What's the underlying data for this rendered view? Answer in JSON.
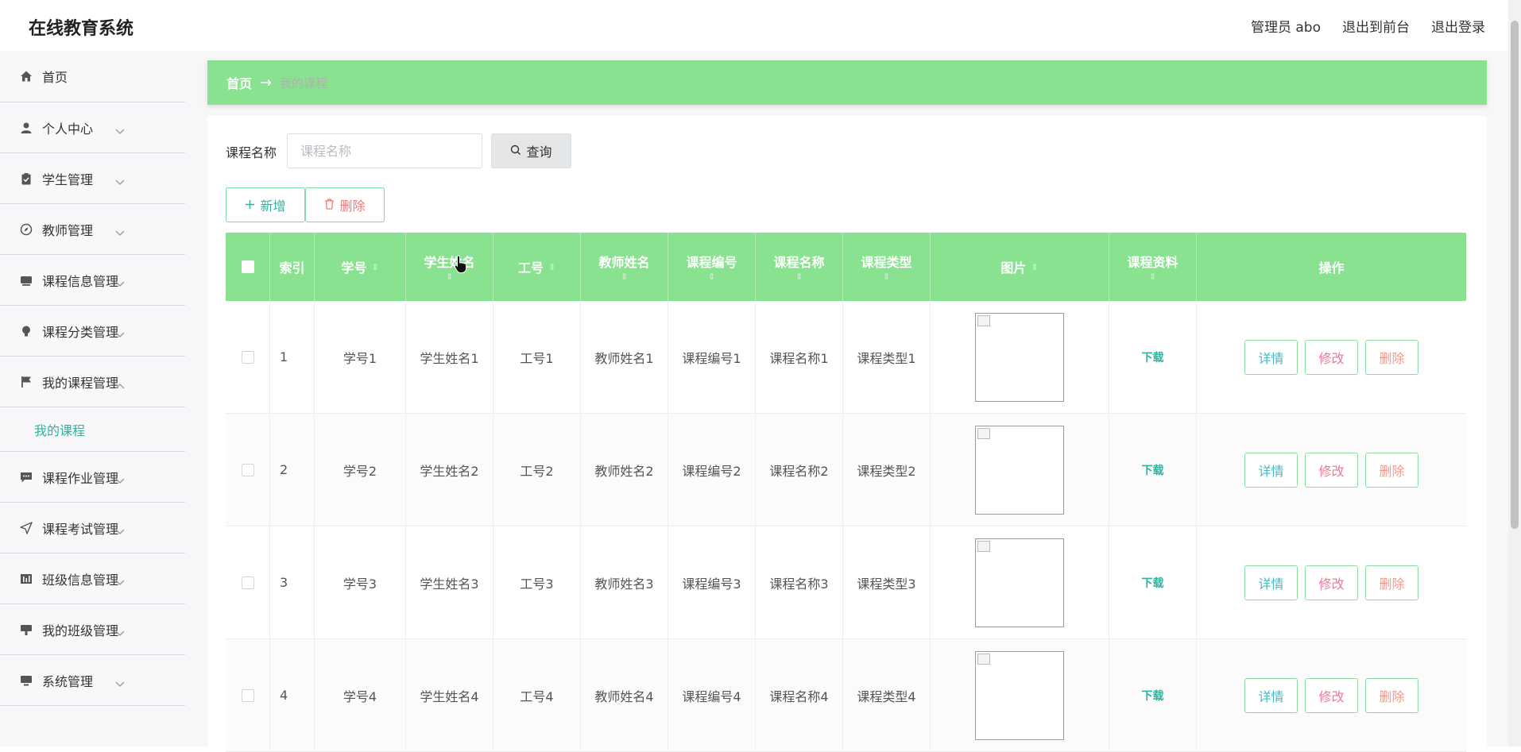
{
  "header": {
    "title": "在线教育系统",
    "user": "管理员 abo",
    "to_front": "退出到前台",
    "logout": "退出登录"
  },
  "sidebar": {
    "items": [
      {
        "label": "首页",
        "icon": "home-icon"
      },
      {
        "label": "个人中心",
        "icon": "user-icon"
      },
      {
        "label": "学生管理",
        "icon": "clipboard-icon"
      },
      {
        "label": "教师管理",
        "icon": "compass-icon"
      },
      {
        "label": "课程信息管理",
        "icon": "monitor-icon"
      },
      {
        "label": "课程分类管理",
        "icon": "bulb-icon"
      },
      {
        "label": "我的课程管理",
        "icon": "flag-icon"
      },
      {
        "label": "课程作业管理",
        "icon": "chat-icon"
      },
      {
        "label": "课程考试管理",
        "icon": "send-icon"
      },
      {
        "label": "班级信息管理",
        "icon": "bars-icon"
      },
      {
        "label": "我的班级管理",
        "icon": "tablet-icon"
      },
      {
        "label": "系统管理",
        "icon": "desktop-icon"
      }
    ],
    "sub_item": "我的课程"
  },
  "breadcrumb": {
    "home": "首页",
    "arrow": "→",
    "current": "我的课程"
  },
  "search": {
    "label": "课程名称",
    "placeholder": "课程名称",
    "button": "查询"
  },
  "actions": {
    "add": "新增",
    "delete": "删除"
  },
  "table": {
    "headers": [
      "索引",
      "学号",
      "学生姓名",
      "工号",
      "教师姓名",
      "课程编号",
      "课程名称",
      "课程类型",
      "图片",
      "课程资料",
      "操作"
    ],
    "rows": [
      {
        "index": "1",
        "student_no": "学号1",
        "student_name": "学生姓名1",
        "teacher_no": "工号1",
        "teacher_name": "教师姓名1",
        "course_no": "课程编号1",
        "course_name": "课程名称1",
        "course_type": "课程类型1",
        "material": "下载"
      },
      {
        "index": "2",
        "student_no": "学号2",
        "student_name": "学生姓名2",
        "teacher_no": "工号2",
        "teacher_name": "教师姓名2",
        "course_no": "课程编号2",
        "course_name": "课程名称2",
        "course_type": "课程类型2",
        "material": "下载"
      },
      {
        "index": "3",
        "student_no": "学号3",
        "student_name": "学生姓名3",
        "teacher_no": "工号3",
        "teacher_name": "教师姓名3",
        "course_no": "课程编号3",
        "course_name": "课程名称3",
        "course_type": "课程类型3",
        "material": "下载"
      },
      {
        "index": "4",
        "student_no": "学号4",
        "student_name": "学生姓名4",
        "teacher_no": "工号4",
        "teacher_name": "教师姓名4",
        "course_no": "课程编号4",
        "course_name": "课程名称4",
        "course_type": "课程类型4",
        "material": "下载"
      }
    ],
    "row_actions": {
      "detail": "详情",
      "edit": "修改",
      "remove": "删除"
    }
  },
  "colors": {
    "accent_green": "#89e28f",
    "teal_text": "#2db3a0",
    "delete_red": "#ef7a7a"
  }
}
